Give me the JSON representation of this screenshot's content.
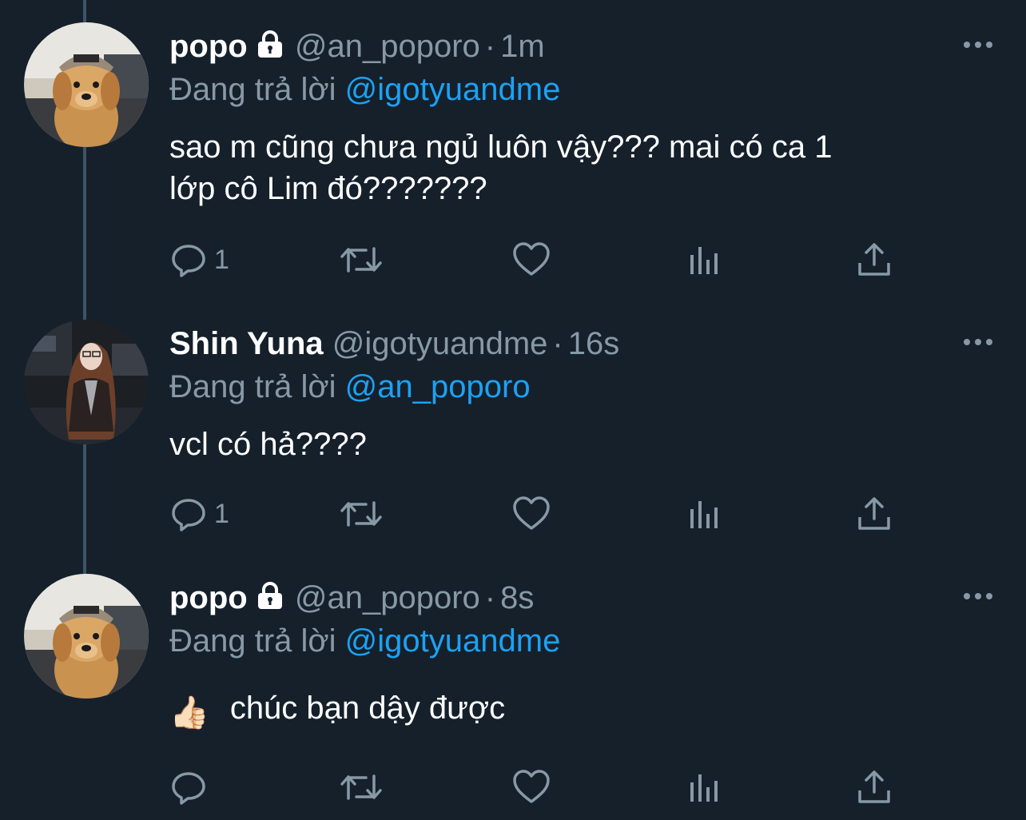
{
  "tweets": [
    {
      "name": "popo",
      "locked": true,
      "handle": "@an_poporo",
      "time": "1m",
      "reply_prefix": "Đang trả lời",
      "reply_to": "@igotyuandme",
      "text_line1": "sao m cũng chưa ngủ luôn vậy??? mai có ca 1",
      "text_line2": "lớp cô Lim đó???????",
      "reply_count": "1",
      "avatar": "golden-retriever-puppy-avatar"
    },
    {
      "name": "Shin Yuna",
      "locked": false,
      "handle": "@igotyuandme",
      "time": "16s",
      "reply_prefix": "Đang trả lời",
      "reply_to": "@an_poporo",
      "text_line1": "vcl có hả????",
      "reply_count": "1",
      "avatar": "girl-night-street-avatar"
    },
    {
      "name": "popo",
      "locked": true,
      "handle": "@an_poporo",
      "time": "8s",
      "reply_prefix": "Đang trả lời",
      "reply_to": "@igotyuandme",
      "emoji": "👍🏻",
      "text_line1": "chúc bạn dậy được",
      "reply_count": "",
      "avatar": "golden-retriever-puppy-avatar"
    }
  ],
  "dot": "·",
  "icons": [
    "reply-icon",
    "retweet-icon",
    "like-icon",
    "analytics-icon",
    "share-icon",
    "more-icon",
    "lock-icon"
  ],
  "colors": {
    "background": "#15202b",
    "muted": "#8899a6",
    "link": "#1da1f2",
    "thread": "#3d5466"
  }
}
